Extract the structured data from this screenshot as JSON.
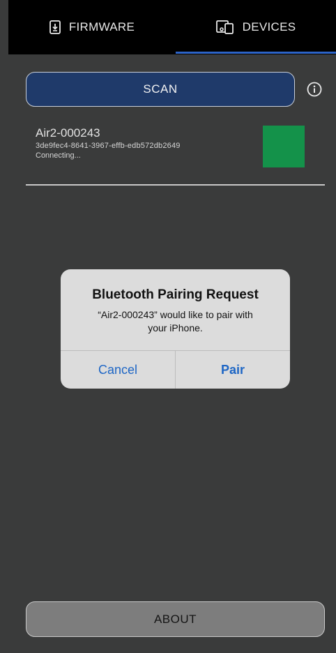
{
  "tabs": {
    "firmware": {
      "label": "FIRMWARE",
      "icon": "download-phone-icon"
    },
    "devices": {
      "label": "DEVICES",
      "icon": "devices-icon",
      "active": true
    }
  },
  "scan": {
    "label": "SCAN",
    "info_icon": "info-icon"
  },
  "device": {
    "name": "Air2-000243",
    "id": "3de9fec4-8641-3967-effb-edb572db2649",
    "status": "Connecting...",
    "status_color": "#14924a"
  },
  "alert": {
    "title": "Bluetooth Pairing Request",
    "message_line1": "“Air2-000243” would like to pair with",
    "message_line2": "your iPhone.",
    "cancel_label": "Cancel",
    "pair_label": "Pair"
  },
  "about": {
    "label": "ABOUT"
  },
  "colors": {
    "background": "#3a3b3b",
    "accent": "#2d64c8",
    "scan_button": "#1f3a6a",
    "alert_button_text": "#1e66c5"
  }
}
